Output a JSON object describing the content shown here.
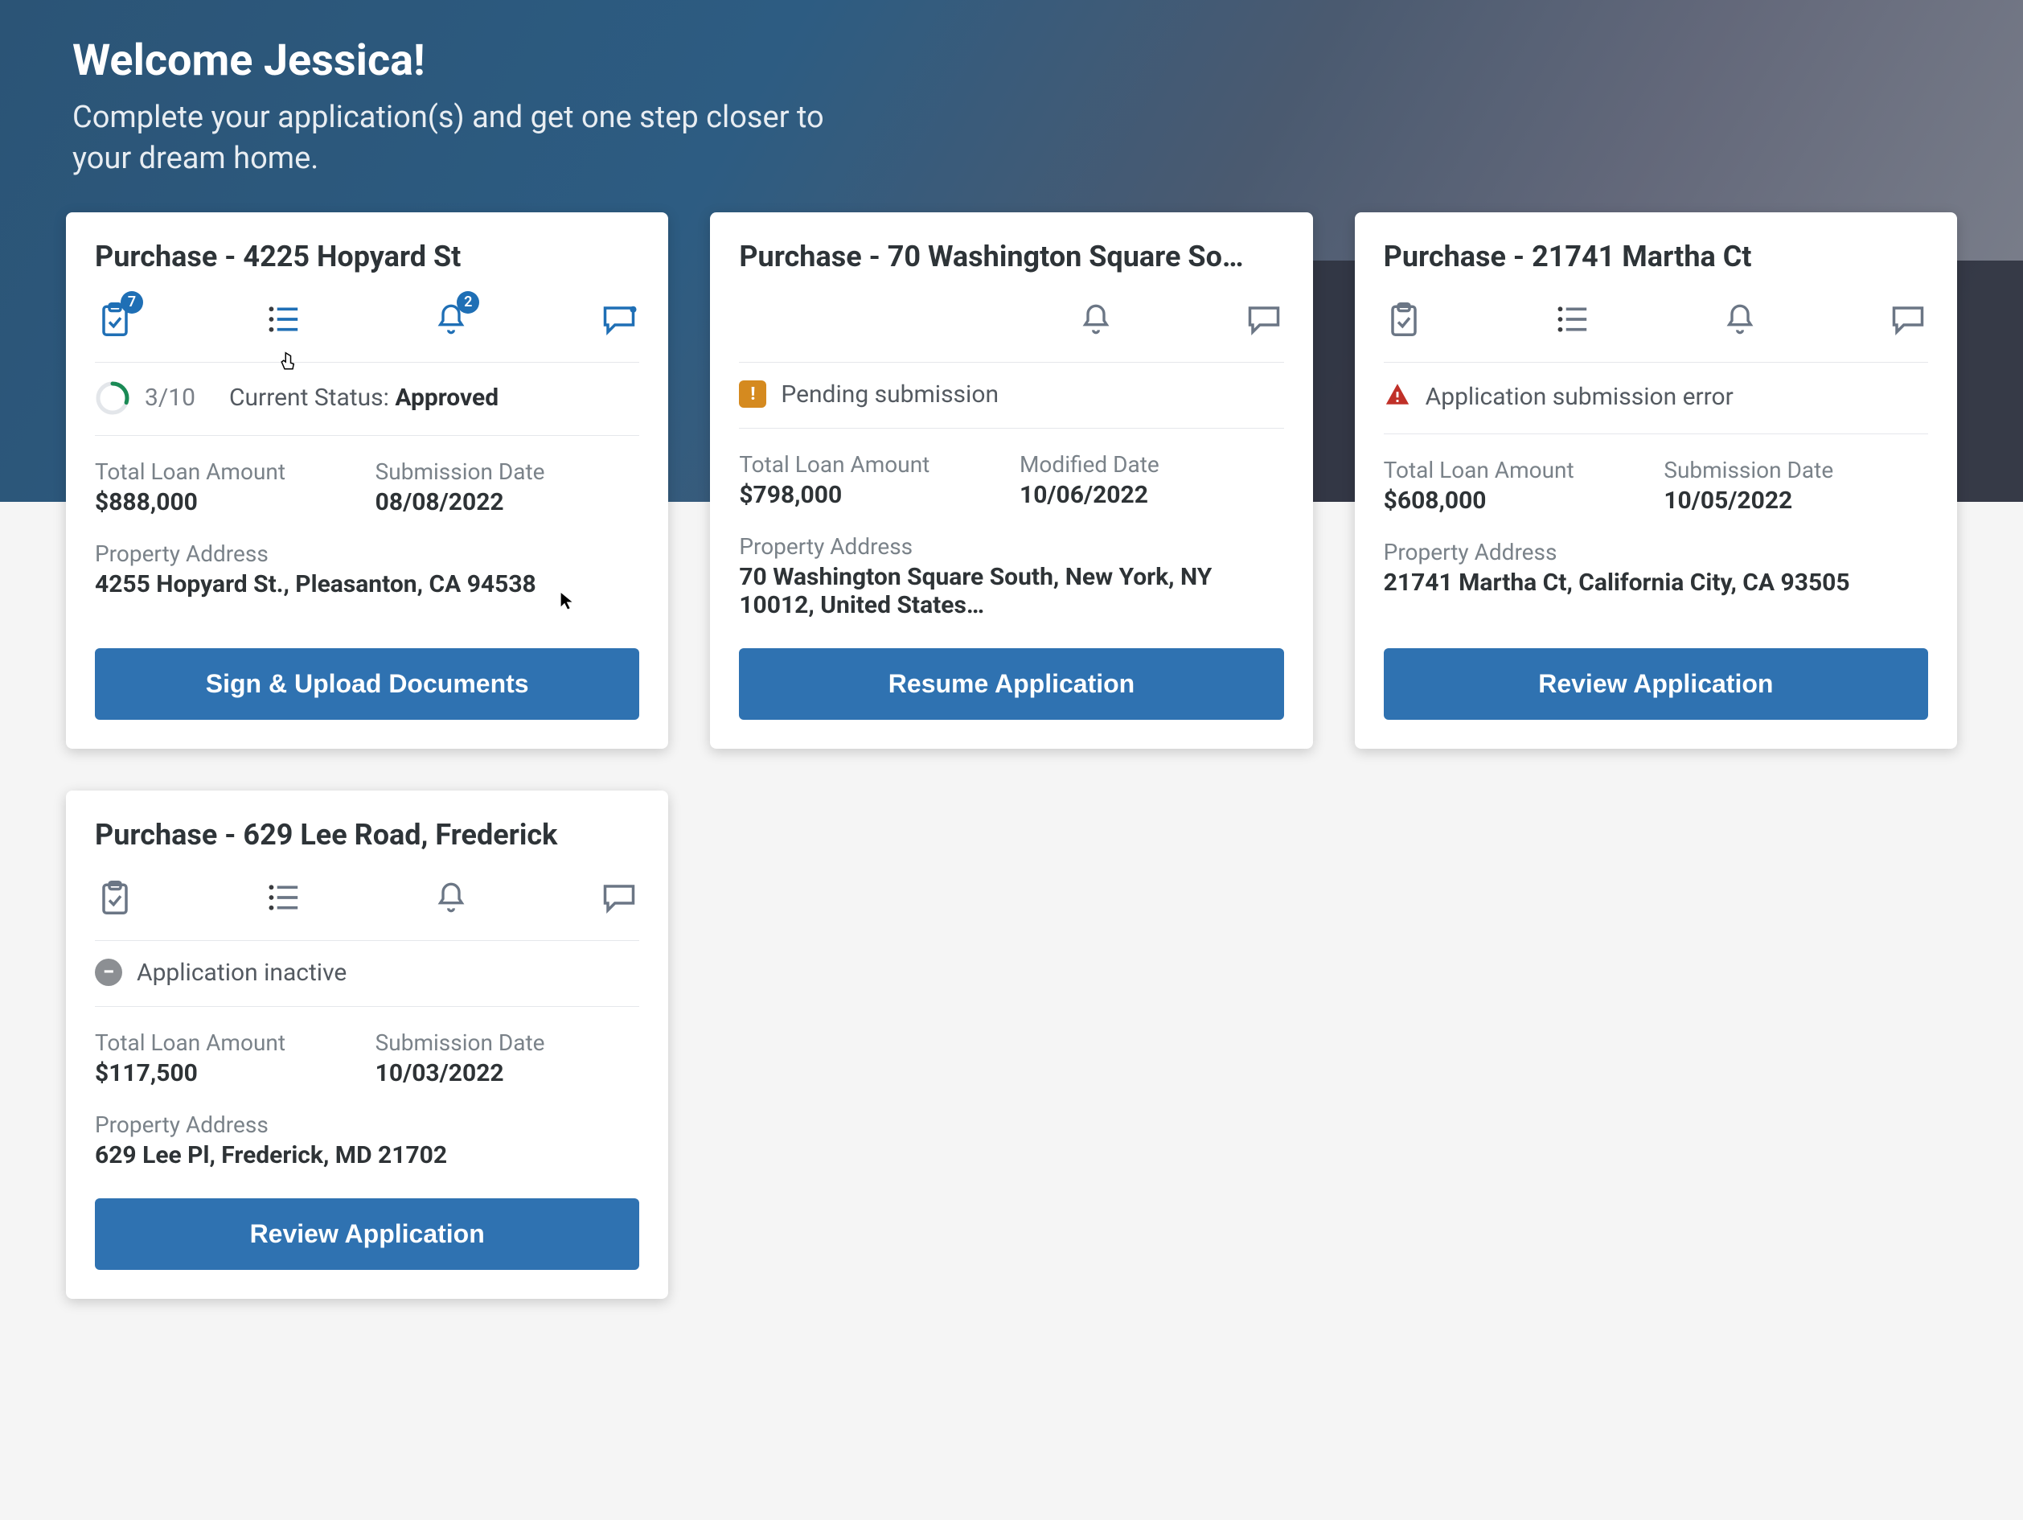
{
  "hero": {
    "title": "Welcome Jessica!",
    "subtitle": "Complete your application(s) and get one step closer to your dream home."
  },
  "labels": {
    "total_loan": "Total Loan Amount",
    "submission_date": "Submission Date",
    "modified_date": "Modified Date",
    "property_address": "Property Address",
    "current_status": "Current Status:"
  },
  "applications": [
    {
      "title": "Purchase - 4225 Hopyard St",
      "icons": {
        "tasks_badge": "7",
        "alerts_badge": "2",
        "first2_hidden": false,
        "active": true,
        "chat_dot": true
      },
      "status": {
        "type": "progress",
        "progress_text": "3/10",
        "progress_fraction": 0.3,
        "status_value": "Approved",
        "text": ""
      },
      "total_loan": "$888,000",
      "date_label_key": "submission_date",
      "date_value": "08/08/2022",
      "address": "4255 Hopyard St., Pleasanton, CA 94538",
      "cta": "Sign & Upload Documents"
    },
    {
      "title": "Purchase - 70 Washington Square So…",
      "icons": {
        "tasks_badge": "",
        "alerts_badge": "",
        "first2_hidden": true,
        "active": false,
        "chat_dot": false
      },
      "status": {
        "type": "pending",
        "text": "Pending submission"
      },
      "total_loan": "$798,000",
      "date_label_key": "modified_date",
      "date_value": "10/06/2022",
      "address": "70 Washington Square South, New York, NY 10012, United States…",
      "cta": "Resume Application"
    },
    {
      "title": "Purchase - 21741 Martha Ct",
      "icons": {
        "tasks_badge": "",
        "alerts_badge": "",
        "first2_hidden": false,
        "active": false,
        "chat_dot": false
      },
      "status": {
        "type": "error",
        "text": "Application submission error"
      },
      "total_loan": "$608,000",
      "date_label_key": "submission_date",
      "date_value": "10/05/2022",
      "address": "21741 Martha Ct, California City, CA 93505",
      "cta": "Review Application"
    },
    {
      "title": "Purchase - 629 Lee Road, Frederick",
      "icons": {
        "tasks_badge": "",
        "alerts_badge": "",
        "first2_hidden": false,
        "active": false,
        "chat_dot": false
      },
      "status": {
        "type": "inactive",
        "text": "Application inactive"
      },
      "total_loan": "$117,500",
      "date_label_key": "submission_date",
      "date_value": "10/03/2022",
      "address": "629 Lee Pl, Frederick, MD 21702",
      "cta": "Review Application"
    }
  ],
  "colors": {
    "primary": "#2f72b1",
    "badge": "#1f6fb5",
    "warning": "#d58a1f",
    "error": "#c03028",
    "muted": "#8c8f93"
  }
}
